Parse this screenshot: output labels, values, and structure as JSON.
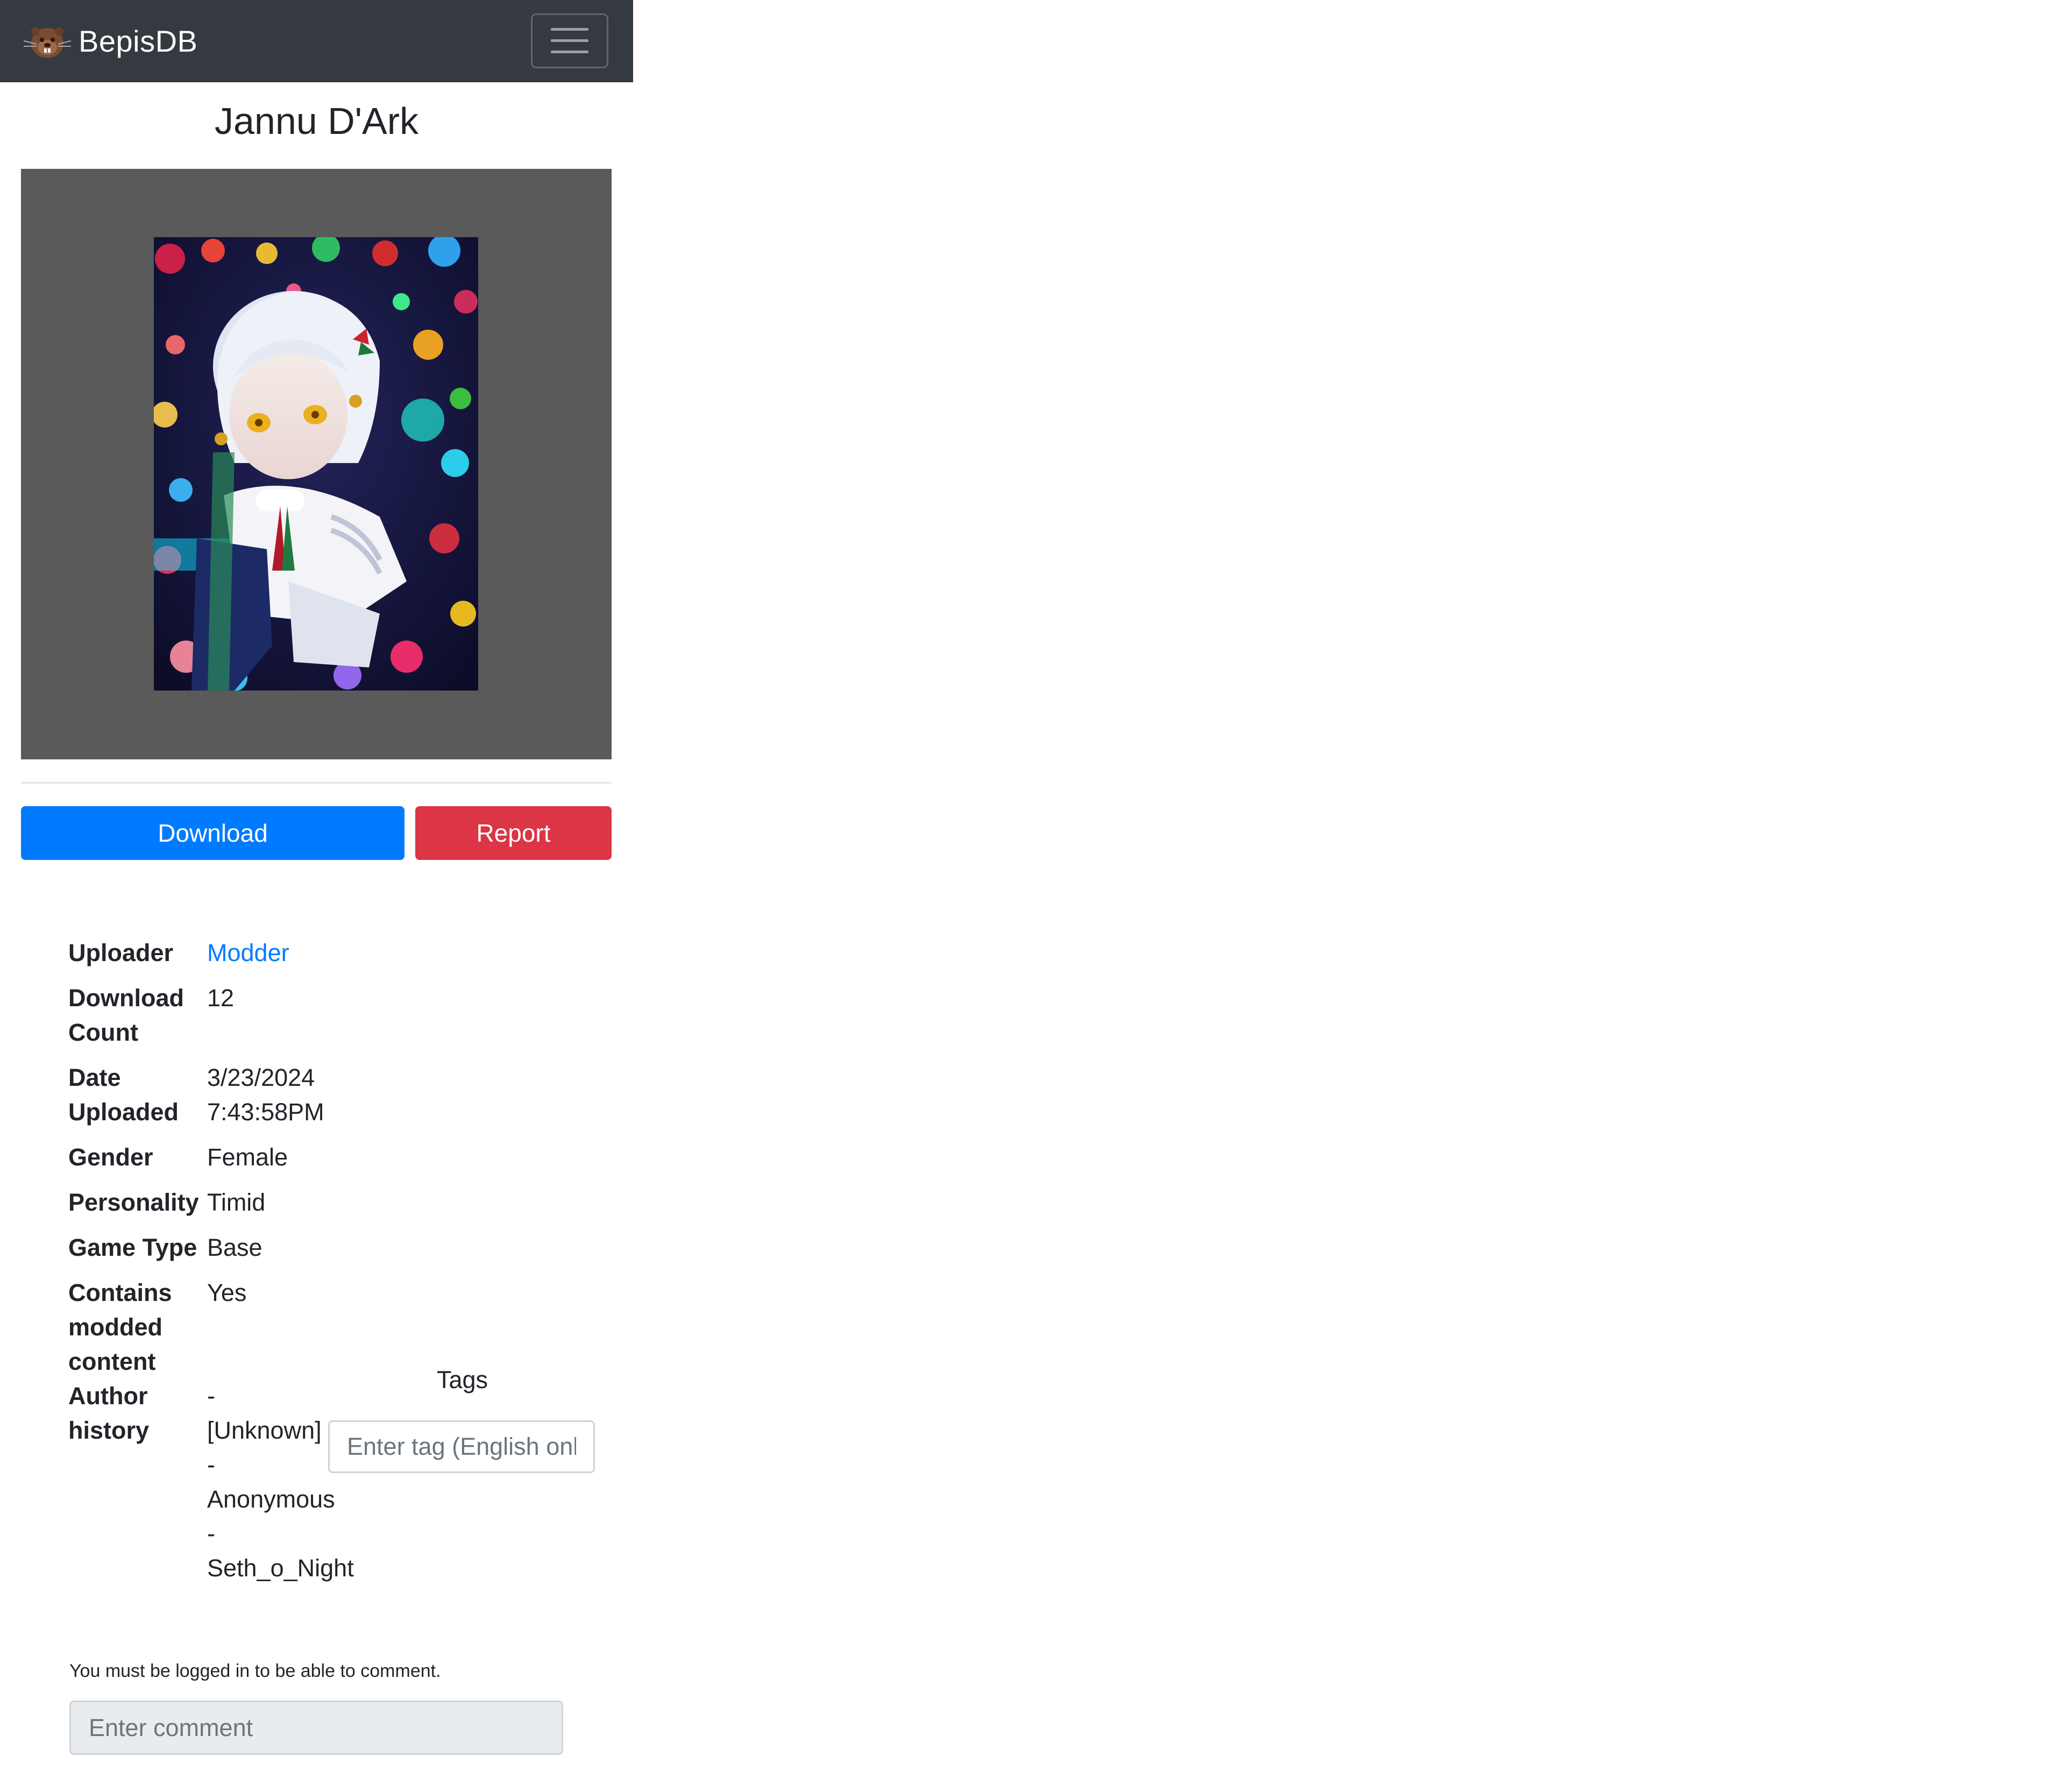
{
  "navbar": {
    "brand_name": "BepisDB",
    "menu_icon": "hamburger-menu-icon"
  },
  "card": {
    "title": "Jannu D'Ark",
    "image": "character-card-image"
  },
  "actions": {
    "download_label": "Download",
    "report_label": "Report",
    "download_color": "#007bff",
    "report_color": "#dc3545"
  },
  "details": {
    "uploader": {
      "label": "Uploader",
      "value": "Modder"
    },
    "download_count": {
      "label": "Download Count",
      "value": "12"
    },
    "date_uploaded": {
      "label": "Date Uploaded",
      "value": "3/23/2024 7:43:58PM"
    },
    "gender": {
      "label": "Gender",
      "value": "Female"
    },
    "personality": {
      "label": "Personality",
      "value": "Timid"
    },
    "game_type": {
      "label": "Game Type",
      "value": "Base"
    },
    "modded": {
      "label": "Contains modded content",
      "value": "Yes"
    },
    "author_history": {
      "label": "Author history",
      "entries": [
        "- [Unknown]",
        "- Anonymous",
        "- Seth_o_Night"
      ]
    }
  },
  "tags": {
    "label": "Tags",
    "placeholder": "Enter tag (English only)"
  },
  "comments": {
    "login_note": "You must be logged in to be able to comment.",
    "placeholder": "Enter comment"
  }
}
